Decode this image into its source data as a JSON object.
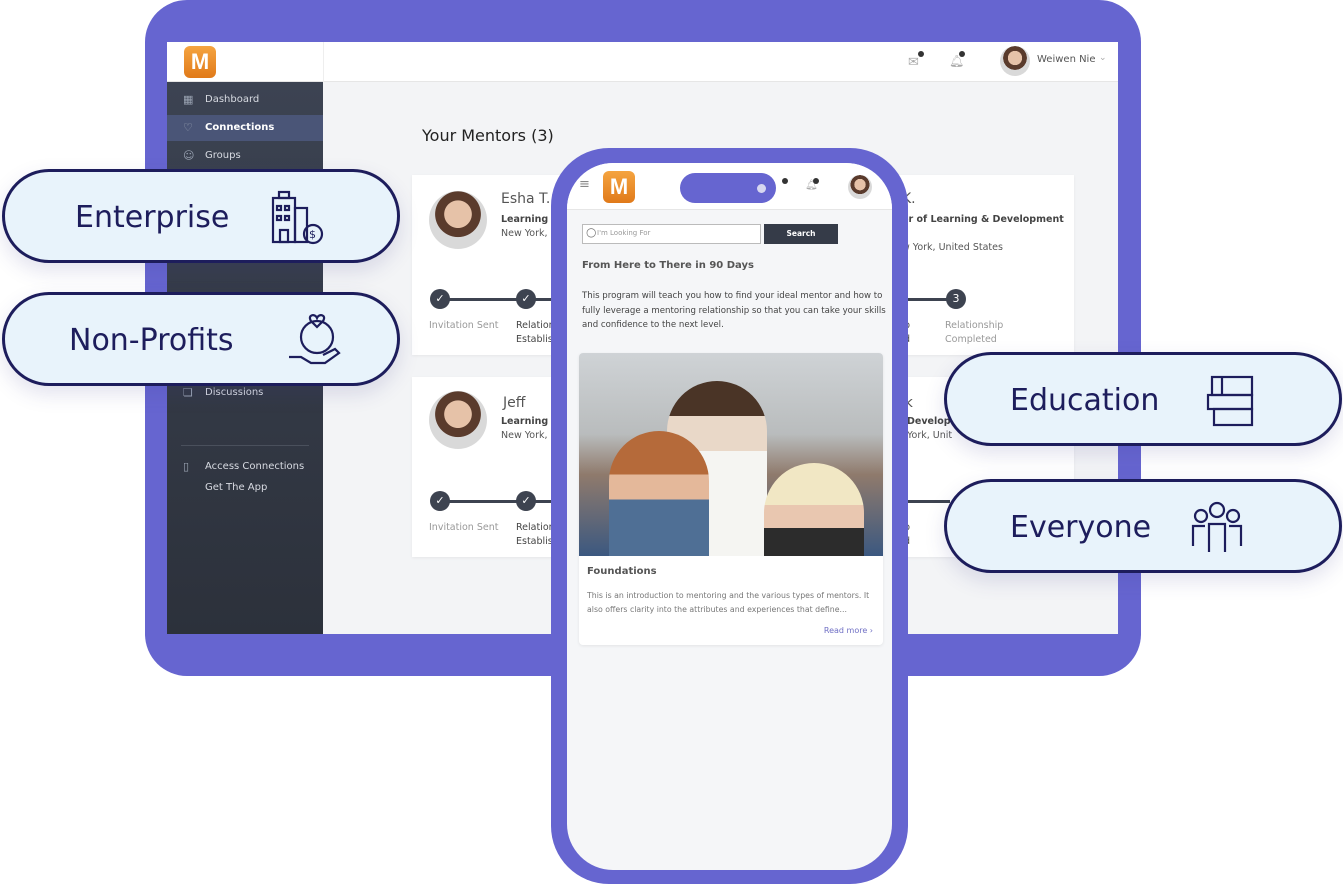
{
  "tablet": {
    "logo": "M",
    "user_name": "Weiwen Nie",
    "sidebar": [
      {
        "label": "Dashboard",
        "icon": "grid-icon"
      },
      {
        "label": "Connections",
        "icon": "handshake-icon",
        "active": true
      },
      {
        "label": "Groups",
        "icon": "people-icon"
      },
      {
        "label": "Discussions",
        "icon": "chat-icon"
      }
    ],
    "access_connections": "Access Connections",
    "get_app": "Get The App",
    "title": "Your Mentors (3)",
    "mentors": [
      {
        "name": "Esha T.",
        "role": "Learning a",
        "location": "New York,",
        "right_name": "K.",
        "right_role": "or of Learning & Development",
        "right_location": "w York, United States",
        "steps": [
          "Invitation Sent",
          "Relation",
          "Establis"
        ],
        "right_steps": [
          "p",
          "d"
        ],
        "final_step": "3",
        "final_label_1": "Relationship",
        "final_label_2": "Completed"
      },
      {
        "name": "Jeff",
        "role": "Learning a",
        "location": "New York,",
        "right_name": "ck",
        "right_role": "Develop",
        "right_location": "York, Unit",
        "steps": [
          "Invitation Sent",
          "Relation",
          "Establis"
        ],
        "right_steps": [
          "p",
          "d"
        ]
      }
    ]
  },
  "phone": {
    "logo": "M",
    "search_placeholder": "I'm Looking For",
    "search_button": "Search",
    "program_title": "From Here to There in 90 Days",
    "program_desc": "This program will teach you how to find your ideal mentor and how to fully leverage a mentoring relationship so that you can take your skills and confidence to the next level.",
    "course_title": "Foundations",
    "course_desc": "This is an introduction to mentoring and the various types of mentors. It also offers clarity into the attributes and experiences that define...",
    "read_more": "Read more ›"
  },
  "pills": [
    {
      "label": "Enterprise",
      "icon": "building-dollar-icon"
    },
    {
      "label": "Non-Profits",
      "icon": "hand-globe-heart-icon"
    },
    {
      "label": "Education",
      "icon": "books-icon"
    },
    {
      "label": "Everyone",
      "icon": "group-icon"
    }
  ],
  "colors": {
    "frame": "#6665d0",
    "pill_bg": "#e8f3fb",
    "pill_border": "#1d1d5c",
    "sidebar": "#353b48",
    "accent": "#f08a24"
  }
}
